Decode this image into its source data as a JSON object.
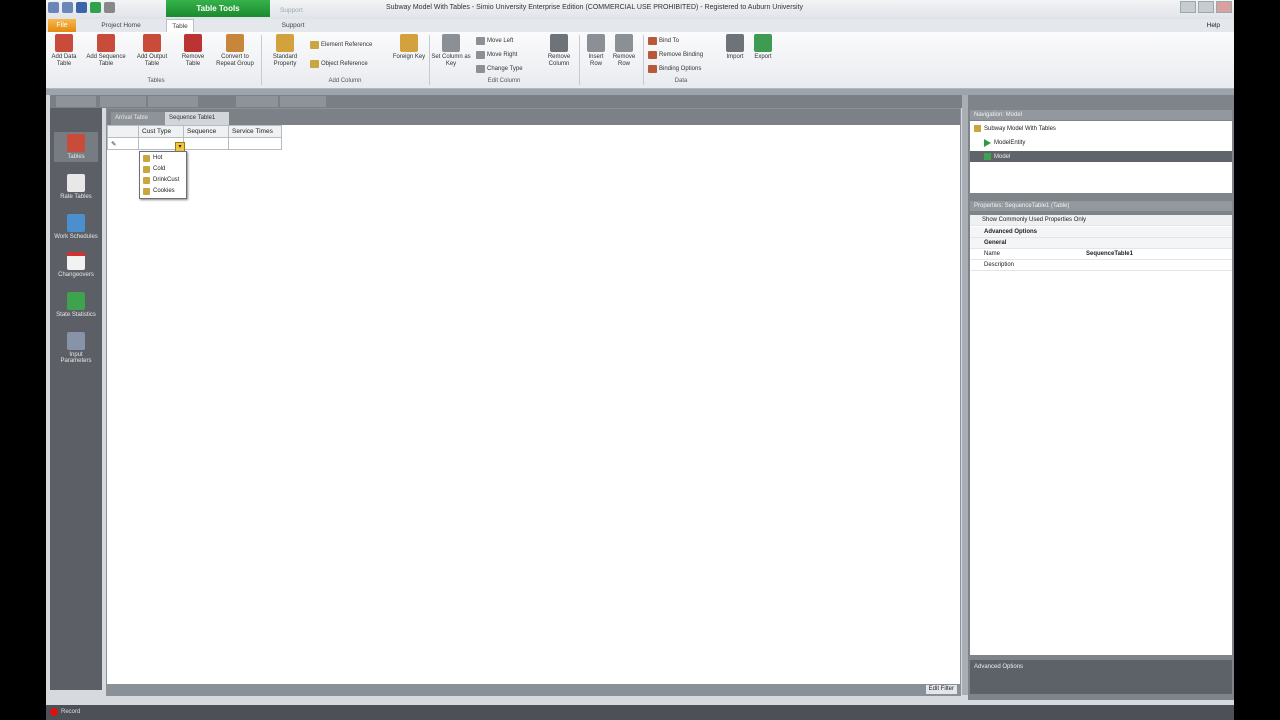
{
  "window": {
    "title": "Subway Model With Tables - Simio University Enterprise Edition (COMMERCIAL USE PROHIBITED) - Registered to Auburn University",
    "contextual_tab": "Table Tools",
    "support_tab_top": "Support"
  },
  "tabs": {
    "file": "File",
    "project_home": "Project Home",
    "table": "Table",
    "support": "Support",
    "help": "Help"
  },
  "ribbon": {
    "add_data_table": "Add Data Table",
    "add_sequence_table": "Add Sequence Table",
    "add_output_table": "Add Output Table",
    "remove_table": "Remove Table",
    "convert_to_repeat_group": "Convert to Repeat Group",
    "tables_group": "Tables",
    "standard_property": "Standard Property",
    "element_reference": "Element Reference",
    "object_reference": "Object Reference",
    "foreign_key": "Foreign Key",
    "add_column_group": "Add Column",
    "set_column_as_key": "Set Column as Key",
    "move_left": "Move Left",
    "move_right": "Move Right",
    "change_type": "Change Type",
    "remove_column": "Remove Column",
    "edit_column_group": "Edit Column",
    "insert_row": "Insert Row",
    "remove_row": "Remove Row",
    "bind_to": "Bind To",
    "remove_binding": "Remove Binding",
    "binding_options": "Binding Options",
    "data_group": "Data",
    "import": "Import",
    "export": "Export"
  },
  "left_nav": [
    {
      "label": "Tables",
      "icon": "tables-icon"
    },
    {
      "label": "Rate Tables",
      "icon": "rate-tables-icon"
    },
    {
      "label": "Work Schedules",
      "icon": "work-schedules-icon"
    },
    {
      "label": "Changeovers",
      "icon": "changeovers-icon"
    },
    {
      "label": "State Statistics",
      "icon": "state-statistics-icon"
    },
    {
      "label": "Input Parameters",
      "icon": "input-parameters-icon"
    }
  ],
  "content": {
    "tabs": [
      "Arrival Table",
      "Sequence Table1"
    ],
    "columns": [
      "",
      "Cust Type",
      "Sequence",
      "Service Times"
    ],
    "row_marker": "✎",
    "dropdown_options": [
      "Hot",
      "Cold",
      "DrinkCust",
      "Cookies"
    ],
    "edit_filter": "Edit Filter"
  },
  "navigation": {
    "header": "Navigation: Model",
    "items": [
      "Subway Model With Tables",
      "ModelEntity",
      "Model"
    ]
  },
  "properties": {
    "header": "Properties: SequenceTable1 (Table)",
    "show_common": "Show Commonly Used Properties Only",
    "advanced_options": "Advanced Options",
    "general": "General",
    "rows": [
      {
        "name": "Name",
        "value": "SequenceTable1"
      },
      {
        "name": "Description",
        "value": ""
      }
    ],
    "desc_title": "Advanced Options"
  },
  "status": {
    "record": "Record"
  },
  "colors": {
    "contextual_green": "#1a8a2e",
    "record_red": "#dd1111"
  }
}
